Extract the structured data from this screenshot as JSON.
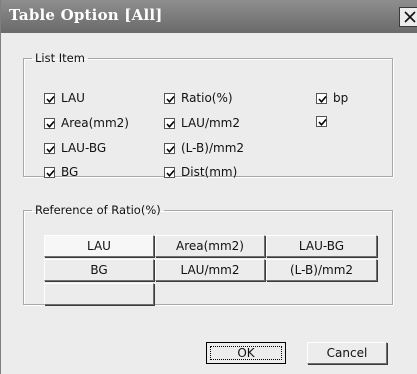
{
  "window": {
    "title": "Table Option [All]",
    "close_icon": "close-x-icon"
  },
  "list_item": {
    "legend": "List Item",
    "items": [
      {
        "label": "LAU",
        "checked": true
      },
      {
        "label": "Area(mm2)",
        "checked": true
      },
      {
        "label": "LAU-BG",
        "checked": true
      },
      {
        "label": "BG",
        "checked": true
      },
      {
        "label": "Ratio(%)",
        "checked": true
      },
      {
        "label": "LAU/mm2",
        "checked": true
      },
      {
        "label": "(L-B)/mm2",
        "checked": true
      },
      {
        "label": "Dist(mm)",
        "checked": true
      },
      {
        "label": "bp",
        "checked": true
      },
      {
        "label": "",
        "checked": true
      }
    ]
  },
  "reference": {
    "legend": "Reference of Ratio(%)",
    "buttons": [
      "LAU",
      "Area(mm2)",
      "LAU-BG",
      "BG",
      "LAU/mm2",
      "(L-B)/mm2",
      ""
    ],
    "selected": "LAU"
  },
  "footer": {
    "ok_label": "OK",
    "cancel_label": "Cancel"
  }
}
